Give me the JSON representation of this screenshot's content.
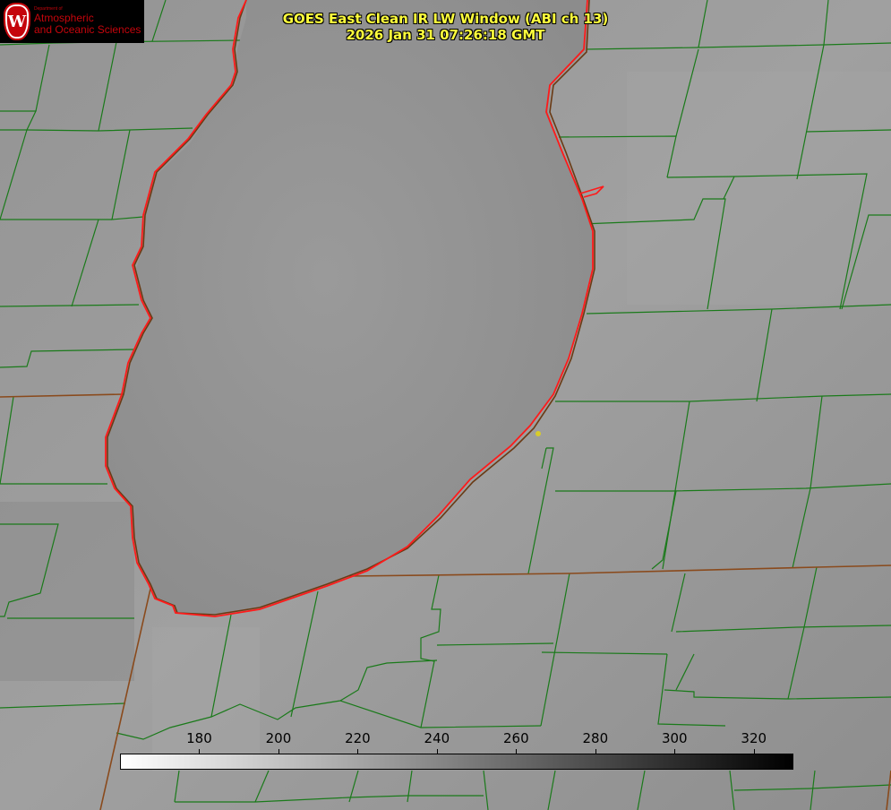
{
  "title_line1": "GOES East Clean IR LW Window (ABI ch 13)",
  "title_line2": "2026 Jan 31 07:26:18 GMT",
  "logo": {
    "seal_letter": "W",
    "department_small": "Department of",
    "line1": "Atmospheric",
    "line2": "and Oceanic Sciences"
  },
  "colors": {
    "title": "#ffff3c",
    "county_lines": "#1a7a1a",
    "state_lines": "#8a4a1c",
    "coastline": "#ff1a1a",
    "logo_red": "#c5050c",
    "station_dot": "#d8cc2a"
  },
  "colorbar": {
    "min": 160,
    "max": 330,
    "ticks": [
      {
        "value": 180,
        "label": "180"
      },
      {
        "value": 200,
        "label": "200"
      },
      {
        "value": 220,
        "label": "220"
      },
      {
        "value": 240,
        "label": "240"
      },
      {
        "value": 260,
        "label": "260"
      },
      {
        "value": 280,
        "label": "280"
      },
      {
        "value": 300,
        "label": "300"
      },
      {
        "value": 320,
        "label": "320"
      }
    ],
    "color_low": "#ffffff",
    "color_high": "#000000"
  }
}
